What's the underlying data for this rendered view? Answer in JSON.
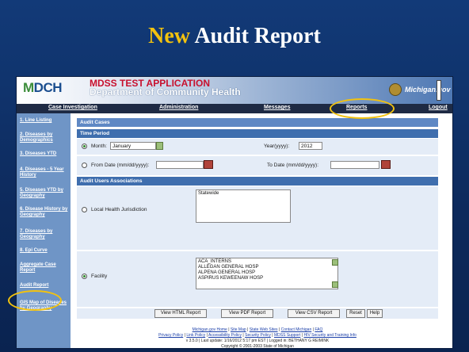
{
  "slide": {
    "title_highlight": "New",
    "title_rest": "Audit Report",
    "accent": "#f2c20f"
  },
  "banner": {
    "logo": {
      "m": "M",
      "rest": "DCH"
    },
    "app_title": "MDSS TEST APPLICATION",
    "app_subtitle": "Department of Community Health",
    "brand_right": "Michigan.gov"
  },
  "nav": {
    "items": [
      "Case Investigation",
      "Administration",
      "Messages",
      "Reports",
      "Logout"
    ]
  },
  "sidebar": {
    "items": [
      "1. Line Listing",
      "2. Diseases by Demographics",
      "3. Diseases YTD",
      "4. Diseases - 5 Year History",
      "5. Diseases YTD by Geography",
      "6. Disease History by Geography",
      "7. Diseases by Geography",
      "8. Epi Curve",
      "Aggregate Case Report",
      "Audit Report",
      "GIS Map of Diseases by Geography"
    ]
  },
  "audit": {
    "section_title": "Audit Cases",
    "time_period": "Time Period",
    "month_label": "Month:",
    "month_value": "January",
    "year_label": "Year(yyyy):",
    "year_value": "2012",
    "from_label": "From Date (mm/dd/yyyy):",
    "from_value": "",
    "to_label": "To Date (mm/dd/yyyy):",
    "to_value": "",
    "users_title": "Audit Users Associations",
    "lhj_label": "Local Health Jurisdiction",
    "lhj_options": [
      "Statewide"
    ],
    "facility_label": "Facility",
    "facility_options": [
      "ACA_INTERNS",
      "ALLEGAN GENERAL HOSP",
      "ALPENA GENERAL HOSP",
      "ASPIRUS KEWEENAW HOSP"
    ]
  },
  "buttons": {
    "html": "View HTML Report",
    "pdf": "View PDF Report",
    "csv": "View CSV Report",
    "reset": "Reset",
    "help": "Help"
  },
  "footer": {
    "line1": [
      "Michigan.gov Home",
      "Site Map",
      "State Web Sites",
      "Contact Michigan",
      "FAQ"
    ],
    "line2": [
      "Privacy Policy",
      "Link Policy",
      "Accessibility Policy",
      "Security Policy",
      "MDSS Support",
      "HIV Security and Training Info"
    ],
    "line3": "v 3.5.0  |  Last update: 1/16/2012 5:17 pm EST  |  Logged in: BETHANY G REIMINK",
    "line4": "Copyright © 2001-2003 State of Michigan",
    "separator": "|"
  }
}
